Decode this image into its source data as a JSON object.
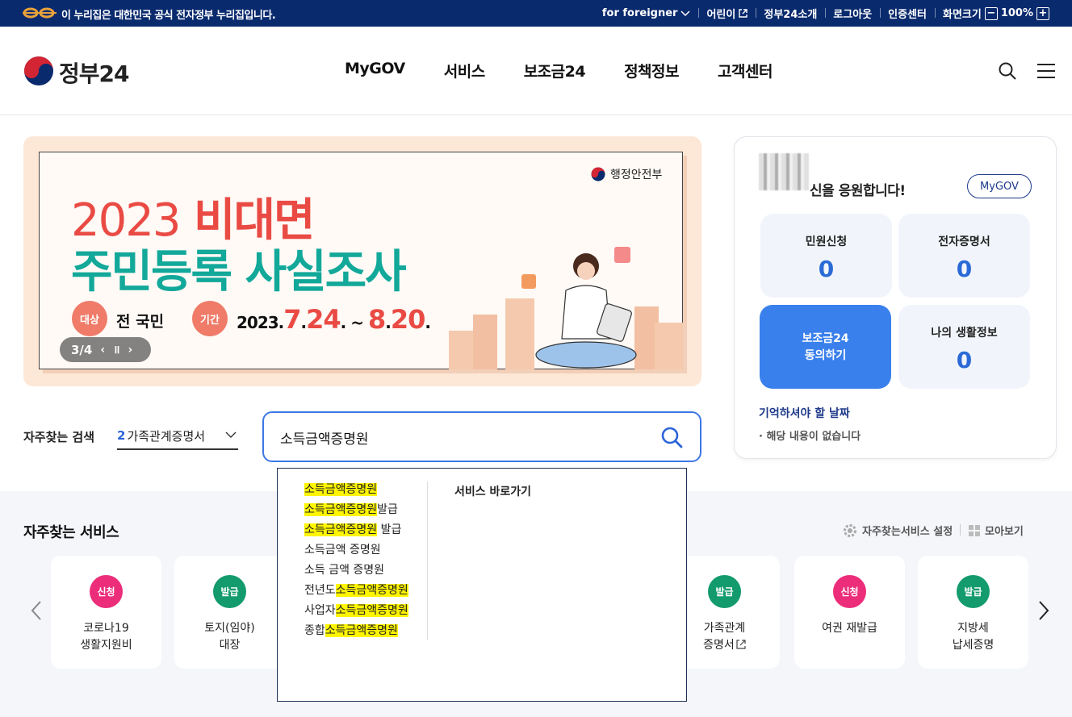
{
  "topbar": {
    "gov_notice": "이 누리집은 대한민국 공식 전자정부 누리집입니다.",
    "for_foreigner": "for foreigner",
    "kids": "어린이",
    "about": "정부24소개",
    "logout": "로그아웃",
    "cert_center": "인증센터",
    "screen_size": "화면크기",
    "zoom_minus": "−",
    "zoom_level": "100%",
    "zoom_plus": "+"
  },
  "header": {
    "logo_text": "정부24",
    "nav": [
      "MyGOV",
      "서비스",
      "보조금24",
      "정책정보",
      "고객센터"
    ]
  },
  "banner": {
    "org": "행정안전부",
    "line1_year": "2023",
    "line1_rest": "비대면",
    "line2": "주민등록 사실조사",
    "target_label": "대상",
    "target_value": "전 국민",
    "period_label": "기간",
    "period_year": "2023.",
    "period_m1": "7",
    "period_sep1": ".",
    "period_d1": "24",
    "period_mid": ". ~ ",
    "period_m2": "8",
    "period_sep2": ".",
    "period_d2": "20",
    "period_end": ".",
    "slide_indicator": "3/4",
    "prev": "‹",
    "pause": "॥",
    "next": "›"
  },
  "frequent_search": {
    "label": "자주찾는 검색",
    "rank": "2",
    "term": "가족관계증명서"
  },
  "search": {
    "value": "소득금액증명원"
  },
  "autocomplete": {
    "suggestions": [
      {
        "pre": "",
        "hl": "소득금액증명원",
        "post": ""
      },
      {
        "pre": "",
        "hl": "소득금액증명원",
        "post": "발급"
      },
      {
        "pre": "",
        "hl": "소득금액증명원",
        "post": " 발급"
      },
      {
        "pre": "소득금액 증명원",
        "hl": "",
        "post": ""
      },
      {
        "pre": "소득 금액 증명원",
        "hl": "",
        "post": ""
      },
      {
        "pre": "전년도",
        "hl": "소득금액증명원",
        "post": ""
      },
      {
        "pre": "사업자",
        "hl": "소득금액증명원",
        "post": ""
      },
      {
        "pre": "종합",
        "hl": "소득금액증명원",
        "post": ""
      }
    ],
    "shortcut_title": "서비스 바로가기"
  },
  "panel": {
    "cheer": "신을 응원합니다!",
    "mygov_button": "MyGOV",
    "tiles": {
      "apply_label": "민원신청",
      "apply_count": "0",
      "ecert_label": "전자증명서",
      "ecert_count": "0",
      "subsidy_line1": "보조금24",
      "subsidy_line2": "동의하기",
      "life_label": "나의 생활정보",
      "life_count": "0"
    },
    "remember_title": "기억하셔야 할 날짜",
    "remember_empty": "해당 내용이 없습니다"
  },
  "services": {
    "title": "자주찾는 서비스",
    "settings": "자주찾는서비스 설정",
    "view_all": "모아보기",
    "cards": [
      {
        "badge": "신청",
        "type": "apply",
        "name": "코로나19\n생활지원비"
      },
      {
        "badge": "발급",
        "type": "issue",
        "name": "토지(임야)\n대장"
      },
      {
        "badge": "발급",
        "type": "issue",
        "name": "가족관계\n증명서"
      },
      {
        "badge": "신청",
        "type": "apply",
        "name": "여권 재발급"
      },
      {
        "badge": "발급",
        "type": "issue",
        "name": "지방세\n납세증명"
      }
    ]
  },
  "colors": {
    "topbar": "#0a2a6e",
    "accent_blue": "#3c77e6",
    "banner_red": "#e94b44",
    "banner_teal": "#12a89a",
    "badge_apply": "#ec2d7a",
    "badge_issue": "#139b6e",
    "highlight": "#fff500"
  }
}
